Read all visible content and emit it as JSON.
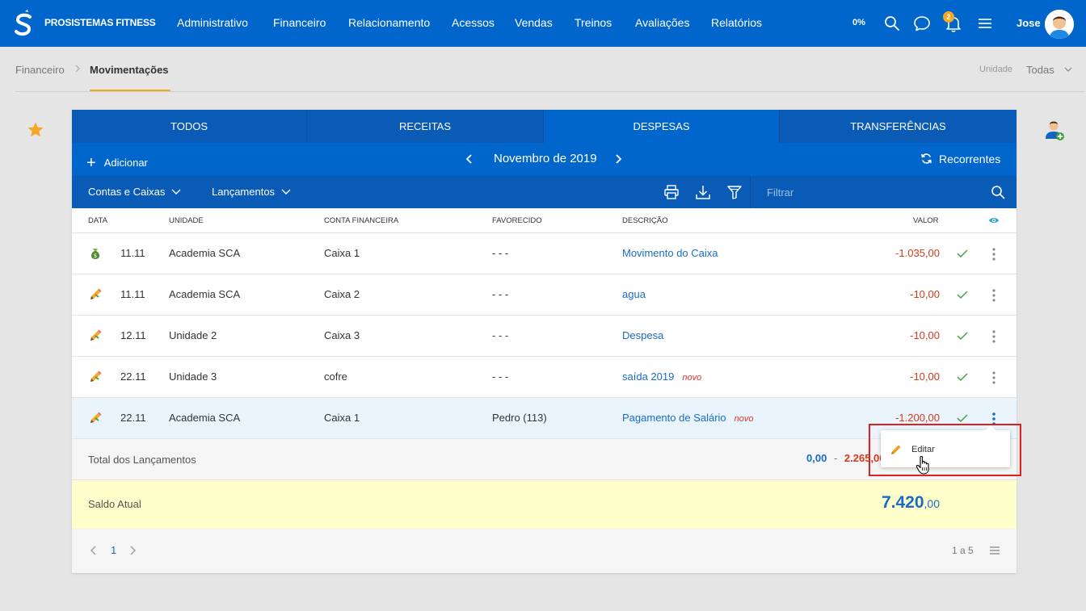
{
  "app": {
    "brand": "PROSISTEMAS FITNESS",
    "nav": [
      "Administrativo",
      "Financeiro",
      "Relacionamento",
      "Acessos",
      "Vendas",
      "Treinos",
      "Avaliações",
      "Relatórios"
    ],
    "percent": "0%",
    "notification_count": "2",
    "username": "Jose"
  },
  "breadcrumb": {
    "root": "Financeiro",
    "current": "Movimentações"
  },
  "unit_filter": {
    "label": "Unidade",
    "value": "Todas"
  },
  "tabs": [
    "TODOS",
    "RECEITAS",
    "DESPESAS",
    "TRANSFERÊNCIAS"
  ],
  "active_tab": "DESPESAS",
  "toolbar": {
    "add_label": "Adicionar",
    "month": "Novembro de 2019",
    "recurring_label": "Recorrentes",
    "accounts_dropdown": "Contas e Caixas",
    "entries_dropdown": "Lançamentos",
    "filter_placeholder": "Filtrar"
  },
  "table": {
    "columns": [
      "DATA",
      "UNIDADE",
      "CONTA FINANCEIRA",
      "FAVORECIDO",
      "DESCRIÇÃO",
      "VALOR"
    ],
    "rows": [
      {
        "icon": "money-bag-icon",
        "date": "11.11",
        "unit": "Academia SCA",
        "account": "Caixa 1",
        "payee": "- - -",
        "description": "Movimento do Caixa",
        "tag": "",
        "value": "-1.035,00"
      },
      {
        "icon": "pencil-icon",
        "date": "11.11",
        "unit": "Academia SCA",
        "account": "Caixa 2",
        "payee": "- - -",
        "description": "agua",
        "tag": "",
        "value": "-10,00"
      },
      {
        "icon": "pencil-icon",
        "date": "12.11",
        "unit": "Unidade 2",
        "account": "Caixa 3",
        "payee": "- - -",
        "description": "Despesa",
        "tag": "",
        "value": "-10,00"
      },
      {
        "icon": "pencil-icon",
        "date": "22.11",
        "unit": "Unidade 3",
        "account": "cofre",
        "payee": "- - -",
        "description": "saída 2019",
        "tag": "novo",
        "value": "-10,00"
      },
      {
        "icon": "pencil-icon",
        "date": "22.11",
        "unit": "Academia SCA",
        "account": "Caixa 1",
        "payee": "Pedro (113)",
        "description": "Pagamento de Salário",
        "tag": "novo",
        "value": "-1.200,00"
      }
    ]
  },
  "totals": {
    "label": "Total dos Lançamentos",
    "income": "0,00",
    "separator": "-",
    "expense": "2.265,00"
  },
  "balance": {
    "label": "Saldo Atual",
    "integer": "7.420",
    "decimal": ",00"
  },
  "pagination": {
    "current_page": "1",
    "range": "1 a 5"
  },
  "context_menu": {
    "edit_label": "Editar"
  },
  "colors": {
    "primary": "#0066cc",
    "primary_dark": "#0a5bb5",
    "accent": "#f5a623",
    "negative": "#d23a1e",
    "link": "#1a6bc4",
    "balance_bg": "#ffffcc",
    "highlight": "#e02020"
  }
}
